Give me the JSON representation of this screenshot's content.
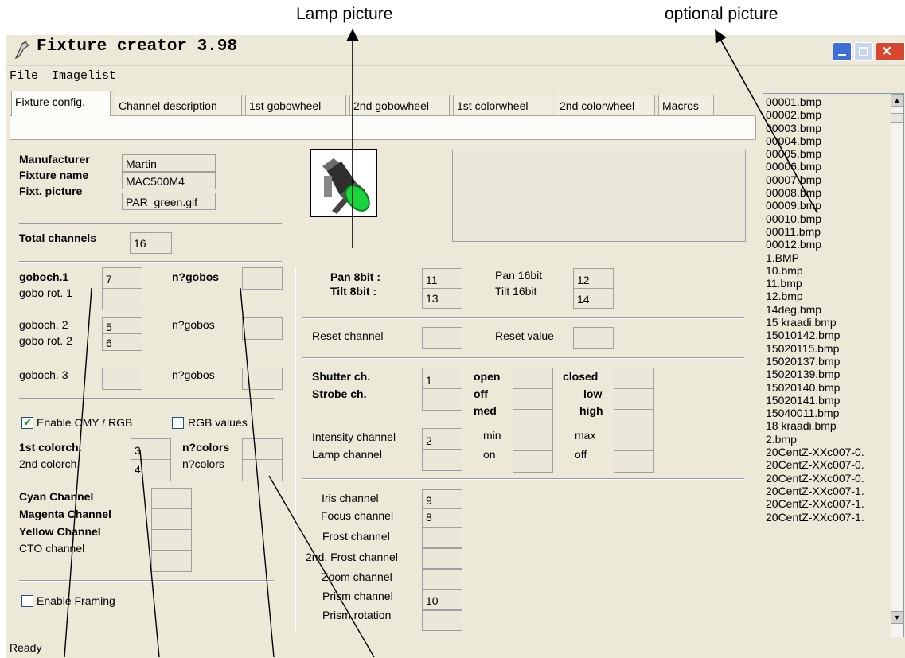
{
  "callouts": {
    "lamp_picture": "Lamp picture",
    "optional_picture": "optional picture"
  },
  "window": {
    "title": "Fixture creator 3.98",
    "menu": [
      "File",
      "Imagelist"
    ],
    "status": "Ready"
  },
  "tabs": [
    "Fixture config.",
    "Channel description",
    "1st gobowheel",
    "2nd gobowheel",
    "1st colorwheel",
    "2nd colorwheel",
    "Macros"
  ],
  "fixture": {
    "manufacturer_label": "Manufacturer",
    "manufacturer": "Martin",
    "name_label": "Fixture name",
    "name": "MAC500M4",
    "picture_label": "Fixt. picture",
    "picture": "PAR_green.gif",
    "total_label": "Total channels",
    "total": "16"
  },
  "gobo": {
    "goboch1_label": "goboch.1",
    "goboch1": "7",
    "ngobos1_label": "n?gobos",
    "ngobos1": "",
    "gobor1_label": "gobo rot. 1",
    "gobor1": "",
    "goboch2_label": "goboch. 2",
    "goboch2": "5",
    "ngobos2_label": "n?gobos",
    "ngobos2": "",
    "gobor2_label": "gobo rot. 2",
    "gobor2": "6",
    "goboch3_label": "goboch. 3",
    "goboch3": "",
    "ngobos3_label": "n?gobos",
    "ngobos3": ""
  },
  "color": {
    "enable_cmy_label": "Enable CMY / RGB",
    "enable_cmy": true,
    "rgb_values_label": "RGB values",
    "rgb_values": false,
    "colorch1_label": "1st colorch.",
    "colorch1": "3",
    "ncolors1_label": "n?colors",
    "ncolors1": "",
    "colorch2_label": "2nd colorch.",
    "colorch2": "4",
    "ncolors2_label": "n?colors",
    "ncolors2": "",
    "cyan_label": "Cyan Channel",
    "magenta_label": "Magenta Channel",
    "yellow_label": "Yellow Channel",
    "cto_label": "CTO channel",
    "framing_label": "Enable Framing",
    "framing": false
  },
  "pantilt": {
    "pan8_label": "Pan 8bit :",
    "pan8": "11",
    "pan16_label": "Pan 16bit",
    "pan16": "12",
    "tilt8_label": "Tilt 8bit :",
    "tilt8": "13",
    "tilt16_label": "Tilt 16bit",
    "tilt16": "14"
  },
  "reset": {
    "channel_label": "Reset channel",
    "channel": "",
    "value_label": "Reset value",
    "value": ""
  },
  "shutter": {
    "shutter_label": "Shutter ch.",
    "shutter": "1",
    "strobe_label": "Strobe ch.",
    "strobe": "",
    "open_label": "open",
    "closed_label": "closed",
    "off_label": "off",
    "low_label": "low",
    "med_label": "med",
    "high_label": "high",
    "intensity_label": "Intensity channel",
    "intensity": "2",
    "min_label": "min",
    "max_label": "max",
    "lamp_label": "Lamp channel",
    "lamp": "",
    "on_label": "on",
    "lamp_off_label": "off"
  },
  "misc": {
    "iris_label": "Iris channel",
    "iris": "9",
    "focus_label": "Focus channel",
    "focus": "8",
    "frost_label": "Frost channel",
    "frost": "",
    "frost2_label": "2nd. Frost channel",
    "frost2": "",
    "zoom_label": "Zoom channel",
    "zoom": "",
    "prism_label": "Prism channel",
    "prism": "10",
    "prismrot_label": "Prism rotation",
    "prismrot": ""
  },
  "imagelist": [
    "00001.bmp",
    "00002.bmp",
    "00003.bmp",
    "00004.bmp",
    "00005.bmp",
    "00006.bmp",
    "00007.bmp",
    "00008.bmp",
    "00009.bmp",
    "00010.bmp",
    "00011.bmp",
    "00012.bmp",
    "1.BMP",
    "10.bmp",
    "11.bmp",
    "12.bmp",
    "14deg.bmp",
    "15 kraadi.bmp",
    "15010142.bmp",
    "15020115.bmp",
    "15020137.bmp",
    "15020139.bmp",
    "15020140.bmp",
    "15020141.bmp",
    "15040011.bmp",
    "18 kraadi.bmp",
    "2.bmp",
    "20CentZ-XXc007-0.",
    "20CentZ-XXc007-0.",
    "20CentZ-XXc007-0.",
    "20CentZ-XXc007-1.",
    "20CentZ-XXc007-1.",
    "20CentZ-XXc007-1."
  ]
}
